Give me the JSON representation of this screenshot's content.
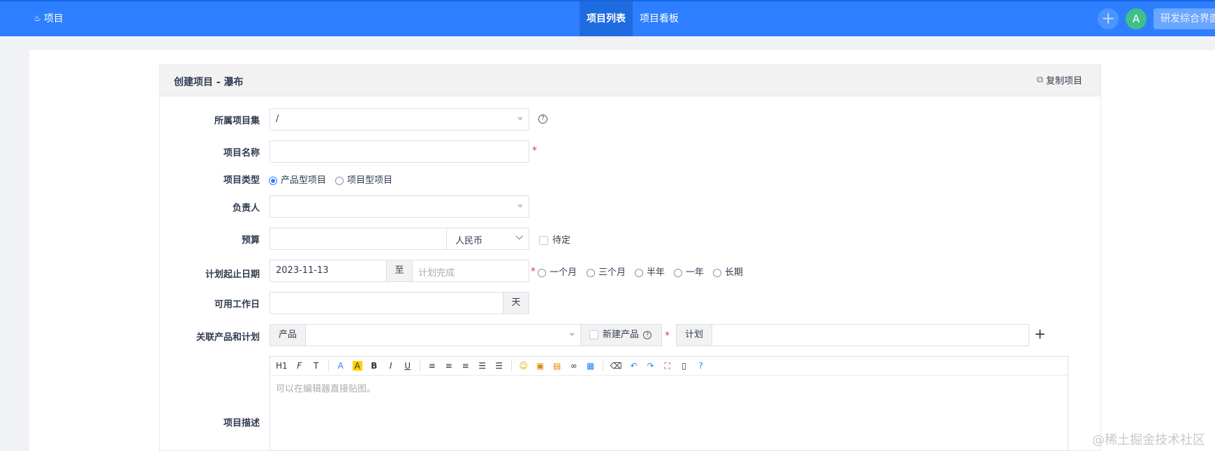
{
  "header": {
    "brand_label": "项目",
    "tabs": [
      "项目列表",
      "项目看板"
    ],
    "avatar_letter": "A",
    "product_switch": "研发综合界面"
  },
  "panel": {
    "title": "创建项目 - 瀑布",
    "copy_label": "复制项目"
  },
  "form": {
    "program_label": "所属项目集",
    "program_value": "/",
    "name_label": "项目名称",
    "type_label": "项目类型",
    "type_options": [
      "产品型项目",
      "项目型项目"
    ],
    "type_selected": "产品型项目",
    "owner_label": "负责人",
    "budget_label": "预算",
    "budget_currency": "人民币",
    "budget_tbd": "待定",
    "date_label": "计划起止日期",
    "date_begin": "2023-11-13",
    "date_to": "至",
    "date_end_placeholder": "计划完成",
    "date_quick": [
      "一个月",
      "三个月",
      "半年",
      "一年",
      "长期"
    ],
    "workdays_label": "可用工作日",
    "workdays_unit": "天",
    "product_plan_label": "关联产品和计划",
    "product_addon": "产品",
    "new_product_label": "新建产品",
    "plan_addon": "计划",
    "desc_label": "项目描述",
    "desc_placeholder": "可以在编辑器直接贴图。"
  },
  "toolbar": {
    "buttons": [
      "H1",
      "F",
      "T",
      "A",
      "A",
      "B",
      "I",
      "U"
    ]
  },
  "watermark": "@稀土掘金技术社区"
}
